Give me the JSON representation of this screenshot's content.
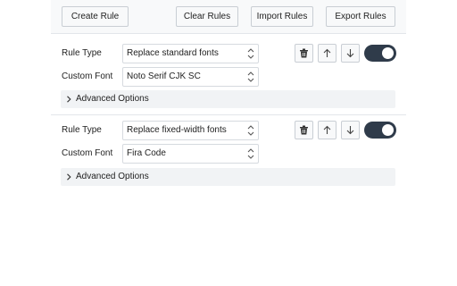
{
  "toolbar": {
    "create_label": "Create Rule",
    "clear_label": "Clear Rules",
    "import_label": "Import Rules",
    "export_label": "Export Rules"
  },
  "rules": [
    {
      "rule_type_label": "Rule Type",
      "rule_type_value": "Replace standard fonts",
      "custom_font_label": "Custom Font",
      "custom_font_value": "Noto Serif CJK SC",
      "advanced_label": "Advanced Options",
      "enabled": true
    },
    {
      "rule_type_label": "Rule Type",
      "rule_type_value": "Replace fixed-width fonts",
      "custom_font_label": "Custom Font",
      "custom_font_value": "Fira Code",
      "advanced_label": "Advanced Options",
      "enabled": true
    }
  ],
  "colors": {
    "toggle_on": "#2f3b4a",
    "toolbar_bg": "#f8f9fa",
    "advanced_bg": "#f1f3f5"
  },
  "icons": [
    "trash-icon",
    "arrow-up-icon",
    "arrow-down-icon",
    "select-arrows-icon",
    "chevron-right-icon"
  ]
}
